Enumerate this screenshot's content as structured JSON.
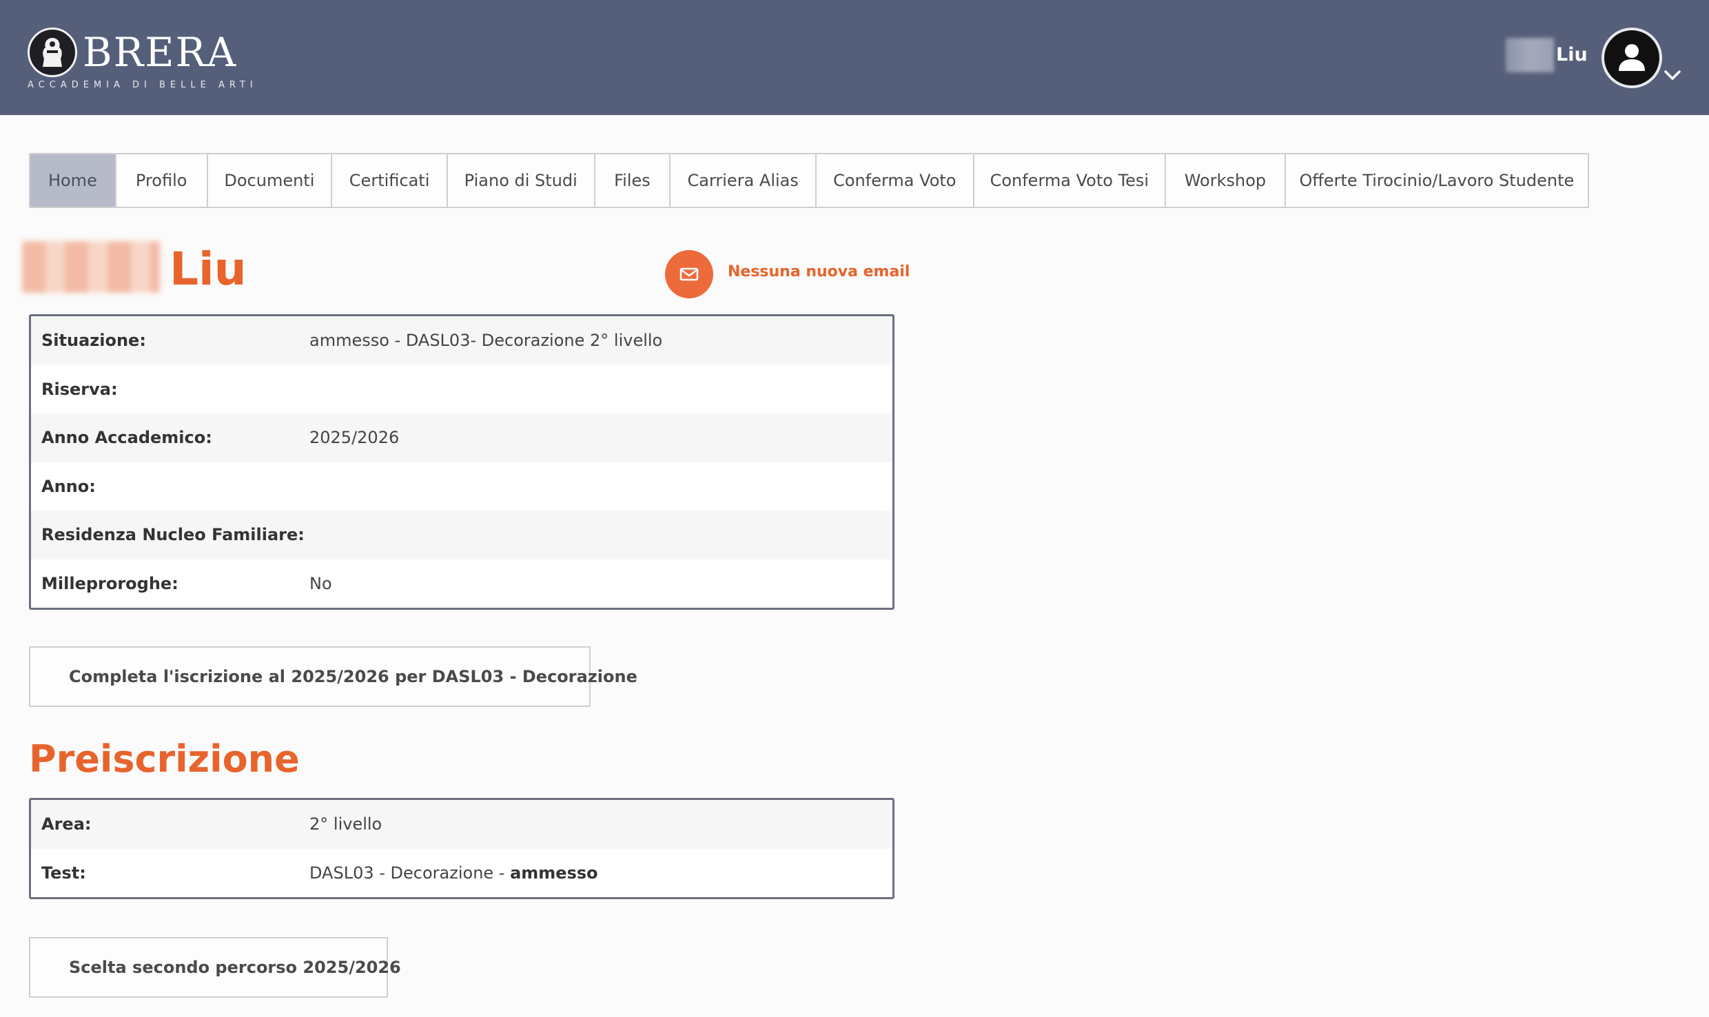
{
  "brand": {
    "name": "BRERA",
    "subtitle": "ACCADEMIA DI BELLE ARTI"
  },
  "user": {
    "name": "Liu",
    "menu_icon": "user-circle-icon"
  },
  "nav": {
    "tabs": [
      {
        "label": "Home",
        "active": true
      },
      {
        "label": "Profilo"
      },
      {
        "label": "Documenti"
      },
      {
        "label": "Certificati"
      },
      {
        "label": "Piano di Studi"
      },
      {
        "label": "Files"
      },
      {
        "label": "Carriera Alias"
      },
      {
        "label": "Conferma Voto"
      },
      {
        "label": "Conferma Voto Tesi"
      },
      {
        "label": "Workshop"
      },
      {
        "label": "Offerte Tirocinio/Lavoro Studente"
      }
    ]
  },
  "student": {
    "last_name": "Liu"
  },
  "email": {
    "status": "Nessuna nuova email"
  },
  "situation": {
    "rows": [
      {
        "label": "Situazione:",
        "value": "ammesso - DASL03- Decorazione 2° livello"
      },
      {
        "label": "Riserva:",
        "value": ""
      },
      {
        "label": "Anno Accademico:",
        "value": "2025/2026"
      },
      {
        "label": "Anno:",
        "value": ""
      },
      {
        "label": "Residenza Nucleo Familiare:",
        "value": ""
      },
      {
        "label": "Milleproroghe:",
        "value": "No"
      }
    ]
  },
  "enroll_button": "Completa l'iscrizione al 2025/2026 per DASL03 - Decorazione",
  "preiscrizione": {
    "title": "Preiscrizione",
    "area_label": "Area:",
    "area_value": "2° livello",
    "test_label": "Test:",
    "test_value": "DASL03 - Decorazione - ",
    "test_status": "ammesso"
  },
  "second_path_button": "Scelta secondo percorso 2025/2026",
  "colors": {
    "header": "#555f7a",
    "accent": "#e8642c",
    "active_tab": "#b6bac9"
  }
}
